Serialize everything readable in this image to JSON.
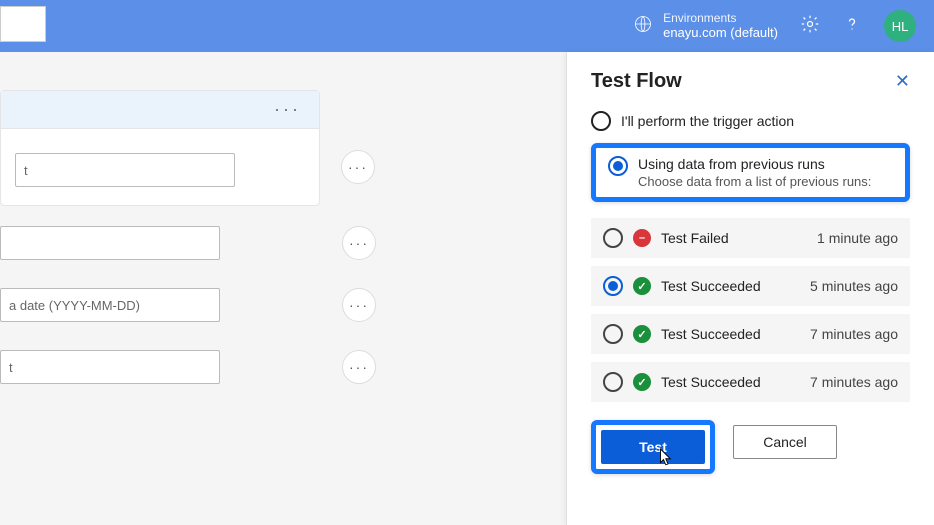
{
  "header": {
    "env_label": "Environments",
    "env_value": "enayu.com (default)",
    "avatar_initials": "HL"
  },
  "background_steps": {
    "input1_placeholder": "t",
    "input2_placeholder": "",
    "input3_placeholder": "a date (YYYY-MM-DD)",
    "input4_placeholder": "t"
  },
  "panel": {
    "title": "Test Flow",
    "radio_manual": "I'll perform the trigger action",
    "radio_previous": "Using data from previous runs",
    "radio_previous_sub": "Choose data from a list of previous runs:",
    "runs": [
      {
        "status": "fail",
        "label": "Test Failed",
        "time": "1 minute ago",
        "selected": false
      },
      {
        "status": "succ",
        "label": "Test Succeeded",
        "time": "5 minutes ago",
        "selected": true
      },
      {
        "status": "succ",
        "label": "Test Succeeded",
        "time": "7 minutes ago",
        "selected": false
      },
      {
        "status": "succ",
        "label": "Test Succeeded",
        "time": "7 minutes ago",
        "selected": false
      }
    ],
    "test_button": "Test",
    "cancel_button": "Cancel"
  }
}
